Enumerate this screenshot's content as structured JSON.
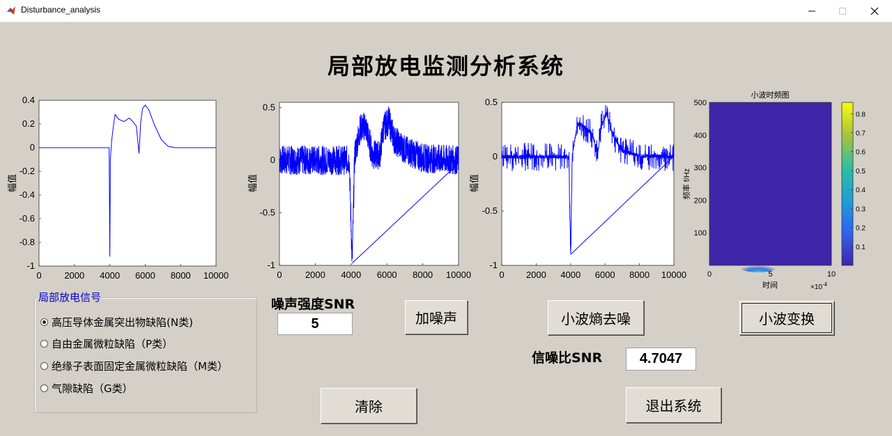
{
  "window": {
    "title": "Disturbance_analysis"
  },
  "heading": "局部放电监测分析系统",
  "plots": [
    {
      "ylabel": "幅值",
      "xticks": [
        "0",
        "2000",
        "4000",
        "6000",
        "8000",
        "10000"
      ],
      "yticks": [
        "0.4",
        "0.2",
        "0",
        "-0.2",
        "-0.4",
        "-0.6",
        "-0.8",
        "-1"
      ]
    },
    {
      "ylabel": "幅值",
      "xticks": [
        "0",
        "2000",
        "4000",
        "6000",
        "8000",
        "10000"
      ],
      "yticks": [
        "0.5",
        "0",
        "-0.5",
        "-1"
      ]
    },
    {
      "ylabel": "幅值",
      "xticks": [
        "0",
        "2000",
        "4000",
        "6000",
        "8000",
        "10000"
      ],
      "yticks": [
        "0.5",
        "0",
        "-0.5",
        "-1"
      ]
    }
  ],
  "spectrogram": {
    "title": "小波时频图",
    "ylabel": "频率 f/Hz",
    "xlabel": "时间",
    "xticks": [
      "0",
      "5",
      "10"
    ],
    "exponent": "×10",
    "exponent_power": "-4",
    "yticks": [
      "500",
      "400",
      "300",
      "200",
      "100"
    ],
    "colorbar_ticks": [
      "0.8",
      "0.7",
      "0.6",
      "0.5",
      "0.4",
      "0.3",
      "0.2",
      "0.1"
    ]
  },
  "group": {
    "title": "局部放电信号",
    "options": [
      {
        "label": "高压导体金属突出物缺陷(N类)",
        "selected": true
      },
      {
        "label": "自由金属微粒缺陷（P类）",
        "selected": false
      },
      {
        "label": "绝缘子表面固定金属微粒缺陷（M类）",
        "selected": false
      },
      {
        "label": "气隙缺陷（G类）",
        "selected": false
      }
    ]
  },
  "noise": {
    "label": "噪声强度SNR",
    "value": "5"
  },
  "buttons": {
    "add_noise": "加噪声",
    "wavelet_denoise": "小波熵去噪",
    "wavelet_transform": "小波变换",
    "clear": "清除",
    "exit": "退出系统"
  },
  "result": {
    "label": "信噪比SNR",
    "value": "4.7047"
  },
  "chart_data": [
    {
      "type": "line",
      "title": "",
      "xlabel": "",
      "ylabel": "幅值",
      "xlim": [
        0,
        10000
      ],
      "ylim": [
        -1,
        0.4
      ],
      "x": [
        0,
        3900,
        3960,
        4000,
        4030,
        4100,
        4200,
        4300,
        4500,
        4800,
        5100,
        5300,
        5500,
        5650,
        5750,
        5850,
        6000,
        6200,
        6500,
        6900,
        7300,
        7700,
        10000
      ],
      "y": [
        0,
        0,
        0,
        -0.92,
        -0.1,
        0.05,
        0.18,
        0.28,
        0.24,
        0.22,
        0.25,
        0.22,
        0.18,
        -0.05,
        0.22,
        0.33,
        0.36,
        0.32,
        0.2,
        0.07,
        0.01,
        0,
        0
      ]
    },
    {
      "type": "line",
      "title": "",
      "xlabel": "",
      "ylabel": "幅值",
      "xlim": [
        0,
        10000
      ],
      "ylim": [
        -1,
        0.55
      ],
      "x": [
        0,
        2000,
        3900,
        4060,
        4200,
        4500,
        4800,
        5200,
        5600,
        5800,
        6100,
        6400,
        7000,
        8000,
        10000
      ],
      "y": [
        0,
        0,
        0,
        -0.98,
        0.05,
        0.3,
        0.33,
        0.05,
        0.05,
        0.3,
        0.38,
        0.2,
        0.1,
        0.02,
        0
      ],
      "noise_amplitude": 0.14
    },
    {
      "type": "line",
      "title": "",
      "xlabel": "",
      "ylabel": "幅值",
      "xlim": [
        0,
        10000
      ],
      "ylim": [
        -1,
        0.5
      ],
      "x": [
        0,
        3900,
        4000,
        4100,
        4400,
        4600,
        4800,
        5200,
        5600,
        5800,
        6100,
        6400,
        7000,
        8000,
        10000
      ],
      "y": [
        0,
        0,
        -0.9,
        0.02,
        0.3,
        0.3,
        0.27,
        0.22,
        0.05,
        0.3,
        0.4,
        0.22,
        0.05,
        0.01,
        0
      ],
      "noise_amplitude": 0.06
    }
  ]
}
